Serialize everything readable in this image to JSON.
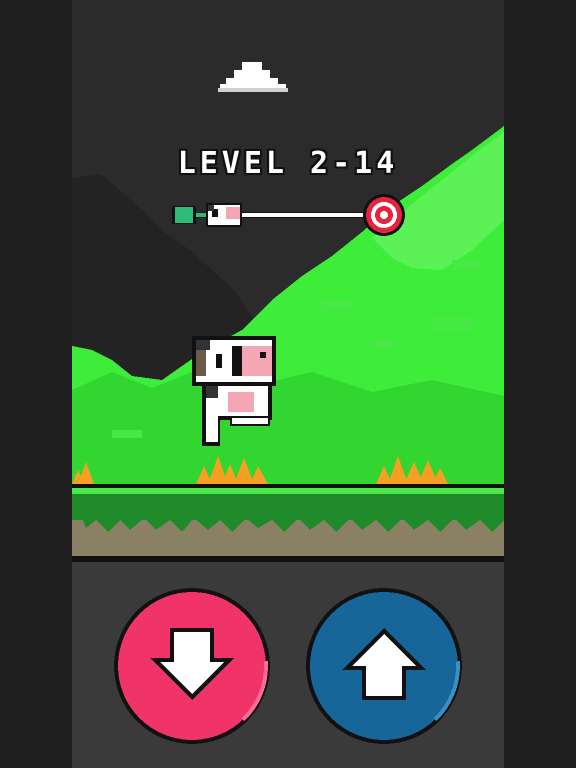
{
  "level": {
    "title": "LEVEL 2-14"
  },
  "progress": {
    "fraction": 0.18
  },
  "controls": {
    "down": {
      "icon": "arrow-down-icon",
      "color": "#f0346a"
    },
    "up": {
      "icon": "arrow-up-icon",
      "color": "#17669a"
    }
  },
  "colors": {
    "sky": "#2b2b2b",
    "hills": "#3ded3a",
    "grass": "#1f8a2a",
    "dirt": "#8a8064",
    "panel": "#3a3a3a",
    "spikes": "#f5a024",
    "progress_done": "#2dbb7a",
    "target": "#e8233b"
  }
}
